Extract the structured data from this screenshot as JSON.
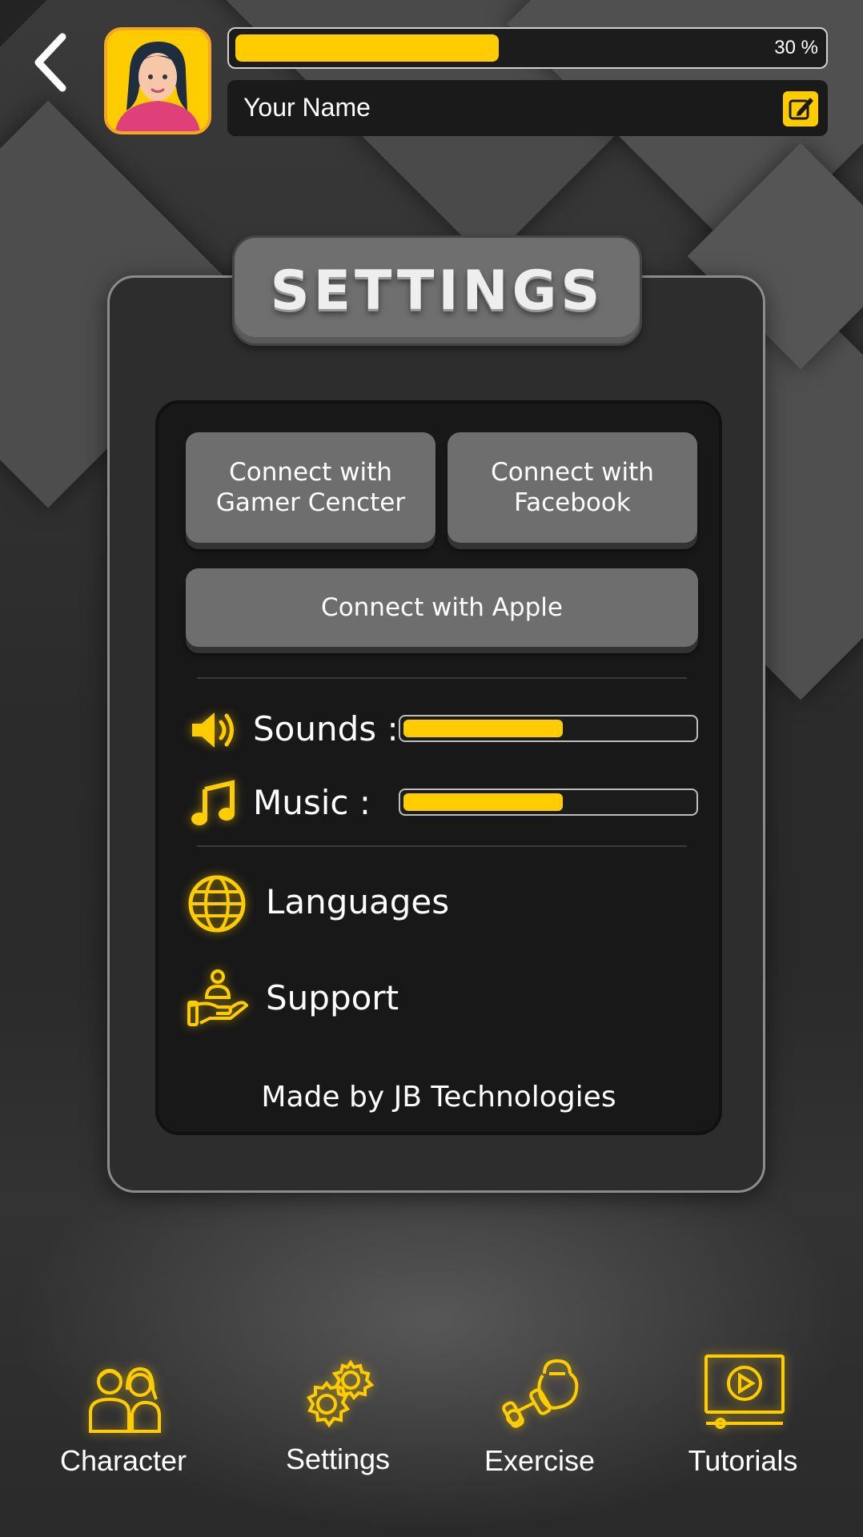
{
  "header": {
    "progress_text": "30 %",
    "progress_fraction": 0.45,
    "player_name": "Your Name"
  },
  "settings": {
    "title": "SETTINGS",
    "connect_gamecenter_line1": "Connect with",
    "connect_gamecenter_line2": "Gamer Cencter",
    "connect_facebook_line1": "Connect with",
    "connect_facebook_line2": "Facebook",
    "connect_apple": "Connect with Apple",
    "sounds_label": "Sounds :",
    "sounds_level": 0.55,
    "music_label": "Music :",
    "music_level": 0.55,
    "languages_label": "Languages",
    "support_label": "Support",
    "footer": "Made by JB Technologies"
  },
  "nav": {
    "items": [
      {
        "label": "Character",
        "icon": "character-icon"
      },
      {
        "label": "Settings",
        "icon": "gears-icon"
      },
      {
        "label": "Exercise",
        "icon": "kettlebell-icon"
      },
      {
        "label": "Tutorials",
        "icon": "video-icon"
      }
    ]
  },
  "colors": {
    "accent": "#ffcc00",
    "avatar_border": "#f5a623",
    "panel": "#2d2d2d",
    "inner_panel": "#181818",
    "button": "#6e6e6e"
  }
}
